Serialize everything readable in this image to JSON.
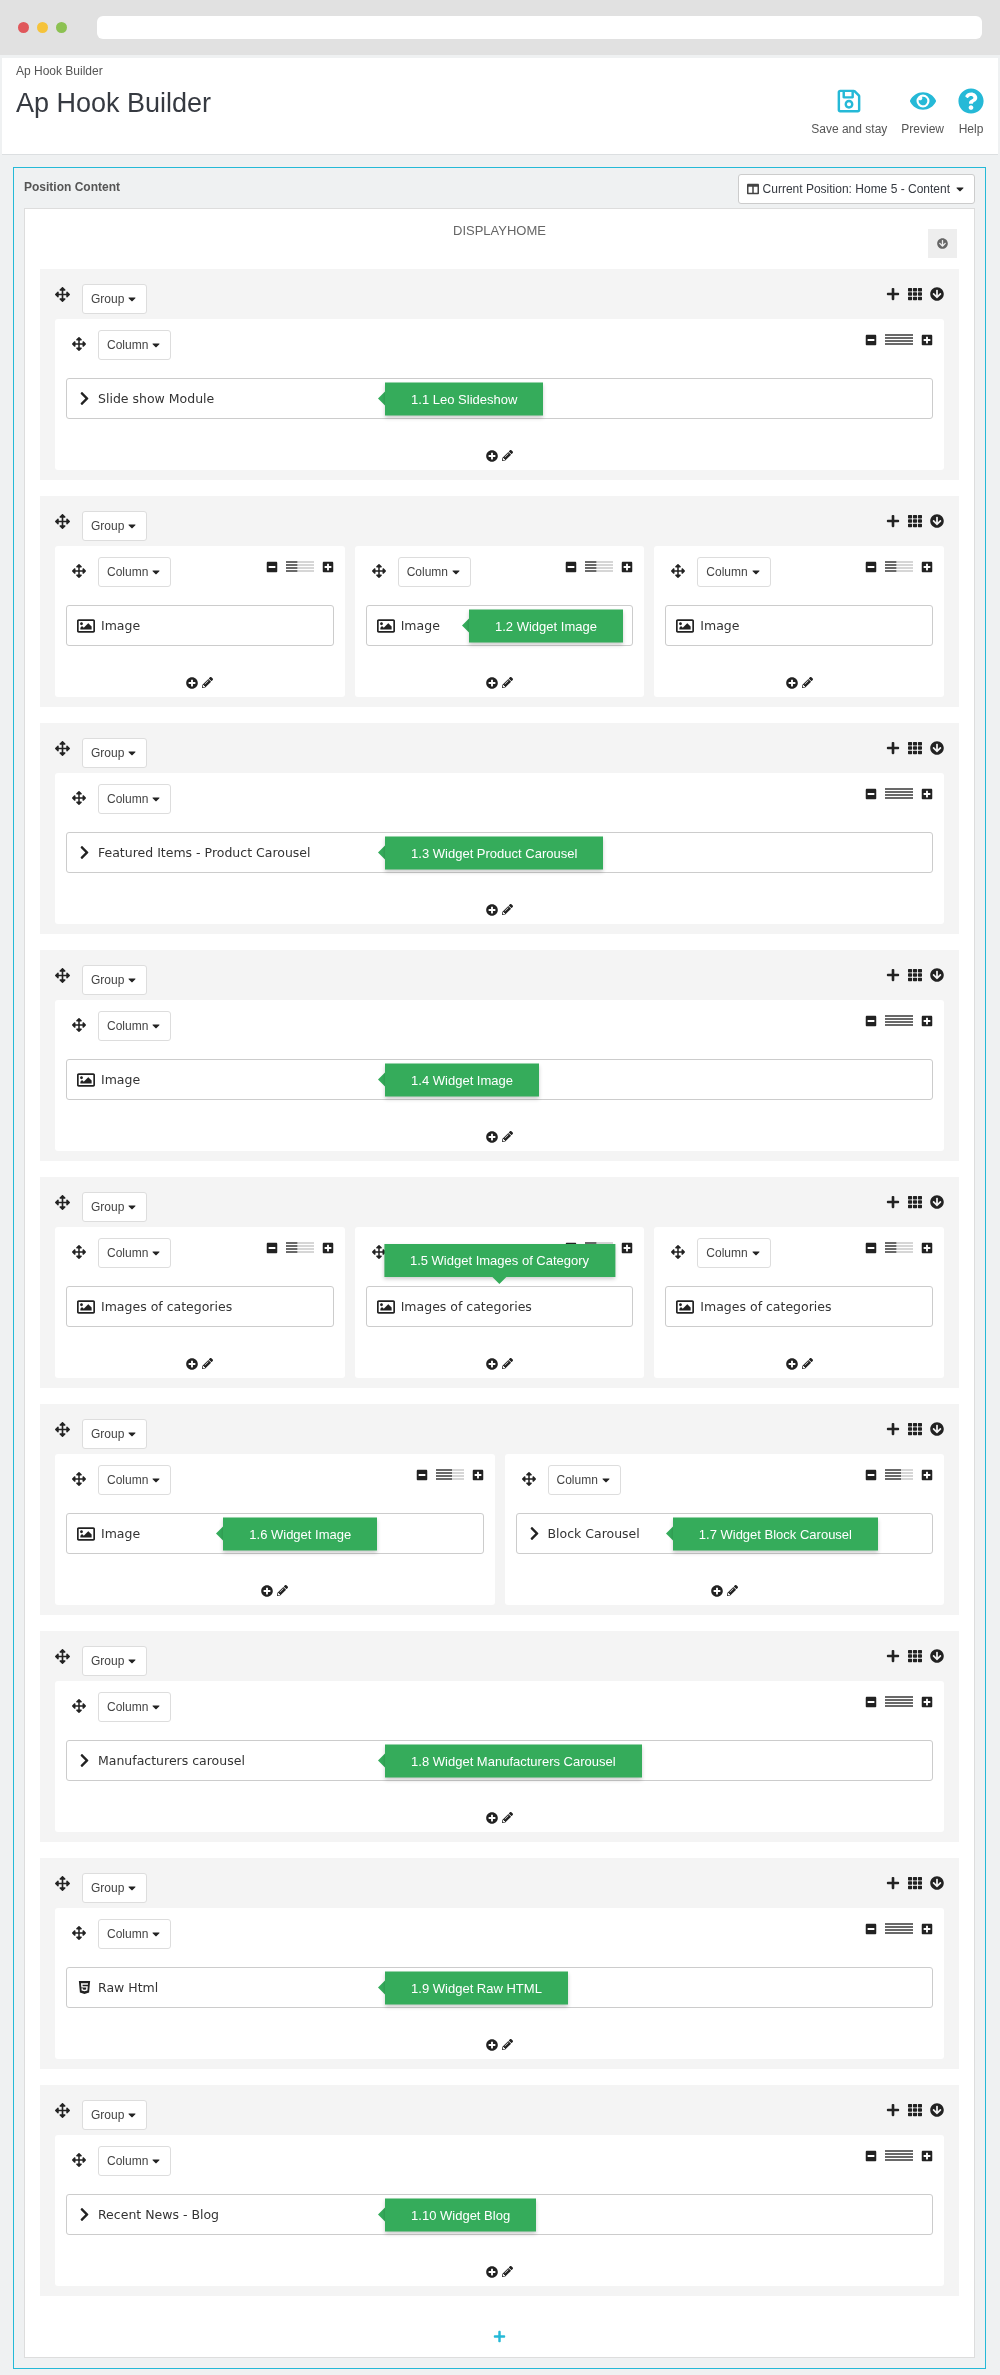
{
  "header": {
    "breadcrumb": "Ap Hook Builder",
    "title": "Ap Hook Builder",
    "toolbar": [
      {
        "kind": "save",
        "label": "Save and stay"
      },
      {
        "kind": "preview",
        "label": "Preview"
      },
      {
        "kind": "help",
        "label": "Help"
      }
    ]
  },
  "panel": {
    "title": "Position Content",
    "position_button": "Current Position: Home 5 - Content",
    "hook_title": "DISPLAYHOME",
    "groups": [
      {
        "label": "Group",
        "columns": [
          {
            "label": "Column",
            "widgets": [
              {
                "kind": "module",
                "name": "Slide show Module",
                "tooltip": {
                  "text": "1.1 Leo Slideshow",
                  "kind": "left"
                }
              }
            ]
          }
        ]
      },
      {
        "label": "Group",
        "columns": [
          {
            "label": "Column",
            "widgets": [
              {
                "kind": "image",
                "name": "Image"
              }
            ]
          },
          {
            "label": "Column",
            "widgets": [
              {
                "kind": "image",
                "name": "Image",
                "tooltip": {
                  "text": "1.2 Widget Image",
                  "kind": "left"
                }
              }
            ]
          },
          {
            "label": "Column",
            "widgets": [
              {
                "kind": "image",
                "name": "Image"
              }
            ]
          }
        ]
      },
      {
        "label": "Group",
        "columns": [
          {
            "label": "Column",
            "widgets": [
              {
                "kind": "module",
                "name": "Featured Items - Product Carousel",
                "tooltip": {
                  "text": "1.3 Widget Product Carousel",
                  "kind": "left"
                }
              }
            ]
          }
        ]
      },
      {
        "label": "Group",
        "columns": [
          {
            "label": "Column",
            "widgets": [
              {
                "kind": "image",
                "name": "Image",
                "tooltip": {
                  "text": "1.4 Widget Image",
                  "kind": "left"
                }
              }
            ]
          }
        ]
      },
      {
        "label": "Group",
        "columns": [
          {
            "label": "Column",
            "widgets": [
              {
                "kind": "image",
                "name": "Images of categories"
              }
            ]
          },
          {
            "widgets": [
              {
                "kind": "image",
                "name": "Images of categories",
                "tooltip": {
                  "text": "1.5 Widget Images of Category",
                  "kind": "top"
                }
              }
            ]
          },
          {
            "label": "Column",
            "widgets": [
              {
                "kind": "image",
                "name": "Images of categories"
              }
            ]
          }
        ]
      },
      {
        "label": "Group",
        "columns": [
          {
            "label": "Column",
            "widgets": [
              {
                "kind": "image",
                "name": "Image",
                "tooltip": {
                  "text": "1.6 Widget Image",
                  "kind": "left"
                }
              }
            ]
          },
          {
            "label": "Column",
            "widgets": [
              {
                "kind": "module",
                "name": "Block Carousel",
                "tooltip": {
                  "text": "1.7 Widget Block Carousel",
                  "kind": "left"
                }
              }
            ]
          }
        ]
      },
      {
        "label": "Group",
        "columns": [
          {
            "label": "Column",
            "widgets": [
              {
                "kind": "module",
                "name": "Manufacturers carousel",
                "tooltip": {
                  "text": "1.8 Widget Manufacturers Carousel",
                  "kind": "left"
                }
              }
            ]
          }
        ]
      },
      {
        "label": "Group",
        "columns": [
          {
            "label": "Column",
            "widgets": [
              {
                "kind": "html",
                "name": "Raw Html",
                "tooltip": {
                  "text": "1.9 Widget Raw HTML",
                  "kind": "left"
                }
              }
            ]
          }
        ]
      },
      {
        "label": "Group",
        "columns": [
          {
            "label": "Column",
            "widgets": [
              {
                "kind": "module",
                "name": "Recent News - Blog",
                "tooltip": {
                  "text": "1.10 Widget Blog",
                  "kind": "left"
                }
              }
            ]
          }
        ]
      }
    ]
  }
}
